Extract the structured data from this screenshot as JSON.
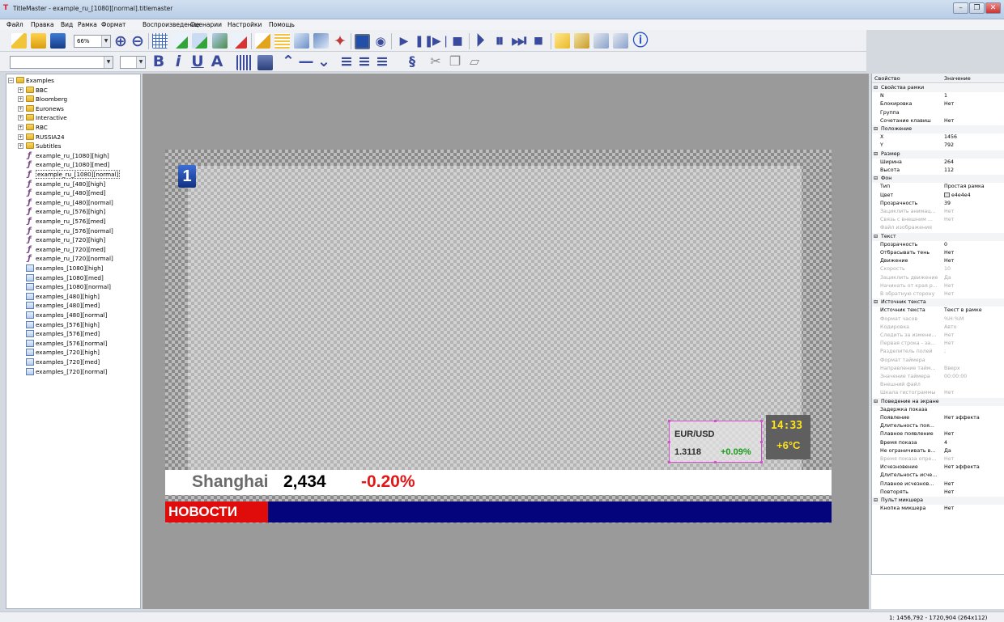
{
  "window": {
    "title": "TitleMaster - example_ru_[1080][normal].titlemaster"
  },
  "menu": [
    "Файл",
    "Правка",
    "Вид",
    "Рамка",
    "Формат",
    "Воспроизведение",
    "Сценарии",
    "Настройки",
    "Помощь"
  ],
  "toolbar": {
    "zoom": "66%"
  },
  "tree": {
    "root": "Examples",
    "folders": [
      "BBC",
      "Bloomberg",
      "Euronews",
      "Interactive",
      "RBC",
      "RUSSIA24",
      "Subtitles"
    ],
    "files": [
      "example_ru_[1080][high]",
      "example_ru_[1080][med]",
      "example_ru_[1080][normal]",
      "example_ru_[480][high]",
      "example_ru_[480][med]",
      "example_ru_[480][normal]",
      "example_ru_[576][high]",
      "example_ru_[576][med]",
      "example_ru_[576][normal]",
      "example_ru_[720][high]",
      "example_ru_[720][med]",
      "example_ru_[720][normal]"
    ],
    "multi": [
      "examples_[1080][high]",
      "examples_[1080][med]",
      "examples_[1080][normal]",
      "examples_[480][high]",
      "examples_[480][med]",
      "examples_[480][normal]",
      "examples_[576][high]",
      "examples_[576][med]",
      "examples_[576][normal]",
      "examples_[720][high]",
      "examples_[720][med]",
      "examples_[720][normal]"
    ],
    "selected": "example_ru_[1080][normal]"
  },
  "stage": {
    "logo": "1",
    "eur_label": "EUR/USD",
    "eur_value": "1.3118",
    "eur_change": "+0.09%",
    "clock": "14:33",
    "temp": "+6°C",
    "ticker_city": "Shanghai",
    "ticker_value": "2,434",
    "ticker_change": "-0.20%",
    "news_label": "НОВОСТИ"
  },
  "props": {
    "col_property": "Свойство",
    "col_value": "Значение",
    "rows": [
      {
        "c": true,
        "k": "Свойства рамки"
      },
      {
        "k": "N",
        "v": "1"
      },
      {
        "k": "Блокировка",
        "v": "Нет"
      },
      {
        "k": "Группа",
        "v": ""
      },
      {
        "k": "Сочетание клавиш",
        "v": "Нет"
      },
      {
        "c": true,
        "k": "Положение"
      },
      {
        "k": "X",
        "v": "1456"
      },
      {
        "k": "Y",
        "v": "792"
      },
      {
        "c": true,
        "k": "Размер"
      },
      {
        "k": "Ширина",
        "v": "264"
      },
      {
        "k": "Высота",
        "v": "112"
      },
      {
        "c": true,
        "k": "Фон"
      },
      {
        "k": "Тип",
        "v": "Простая рамка"
      },
      {
        "k": "Цвет",
        "v": "e4e4e4",
        "sw": true
      },
      {
        "k": "Прозрачность",
        "v": "39"
      },
      {
        "k": "Зациклить анимац...",
        "v": "Нет",
        "d": true
      },
      {
        "k": "Связь с внешним ...",
        "v": "Нет",
        "d": true
      },
      {
        "k": "Файл изображения",
        "v": "",
        "d": true
      },
      {
        "c": true,
        "k": "Текст"
      },
      {
        "k": "Прозрачность",
        "v": "0"
      },
      {
        "k": "Отбрасывать тень",
        "v": "Нет"
      },
      {
        "k": "Движение",
        "v": "Нет"
      },
      {
        "k": "Скорость",
        "v": "10",
        "d": true
      },
      {
        "k": "Зациклить движение",
        "v": "Да",
        "d": true
      },
      {
        "k": "Начинать от края р...",
        "v": "Нет",
        "d": true
      },
      {
        "k": "В обратную сторону",
        "v": "Нет",
        "d": true
      },
      {
        "c": true,
        "k": "Источник текста"
      },
      {
        "k": "Источник текста",
        "v": "Текст в рамке"
      },
      {
        "k": "Формат часов",
        "v": "%H:%M",
        "d": true
      },
      {
        "k": "Кодировка",
        "v": "Авто",
        "d": true
      },
      {
        "k": "Следить за измене...",
        "v": "Нет",
        "d": true
      },
      {
        "k": "Первая строка - за...",
        "v": "Нет",
        "d": true
      },
      {
        "k": "Разделитель полей",
        "v": ";",
        "d": true
      },
      {
        "k": "Формат таймера",
        "v": "",
        "d": true
      },
      {
        "k": "Направление тайм...",
        "v": "Вверх",
        "d": true
      },
      {
        "k": "Значение таймера",
        "v": "00:00:00",
        "d": true
      },
      {
        "k": "Внешний файл",
        "v": "",
        "d": true
      },
      {
        "k": "Шкала гистограммы",
        "v": "Нет",
        "d": true
      },
      {
        "c": true,
        "k": "Поведение на экране"
      },
      {
        "k": "Задержка показа",
        "v": ""
      },
      {
        "k": "Появление",
        "v": "Нет эффекта"
      },
      {
        "k": "Длительность поя...",
        "v": ""
      },
      {
        "k": "Плавное появление",
        "v": "Нет"
      },
      {
        "k": "Время показа",
        "v": "4"
      },
      {
        "k": "Не ограничивать в...",
        "v": "Да"
      },
      {
        "k": "Время показа опре...",
        "v": "Нет",
        "d": true
      },
      {
        "k": "Исчезновение",
        "v": "Нет эффекта"
      },
      {
        "k": "Длительность исче...",
        "v": ""
      },
      {
        "k": "Плавное исчезнов...",
        "v": "Нет"
      },
      {
        "k": "Повторять",
        "v": "Нет"
      },
      {
        "c": true,
        "k": "Пульт микшера"
      },
      {
        "k": "Кнопка микшера",
        "v": "Нет"
      }
    ]
  },
  "status": {
    "text": "1: 1456,792 - 1720,904 (264x112)"
  }
}
